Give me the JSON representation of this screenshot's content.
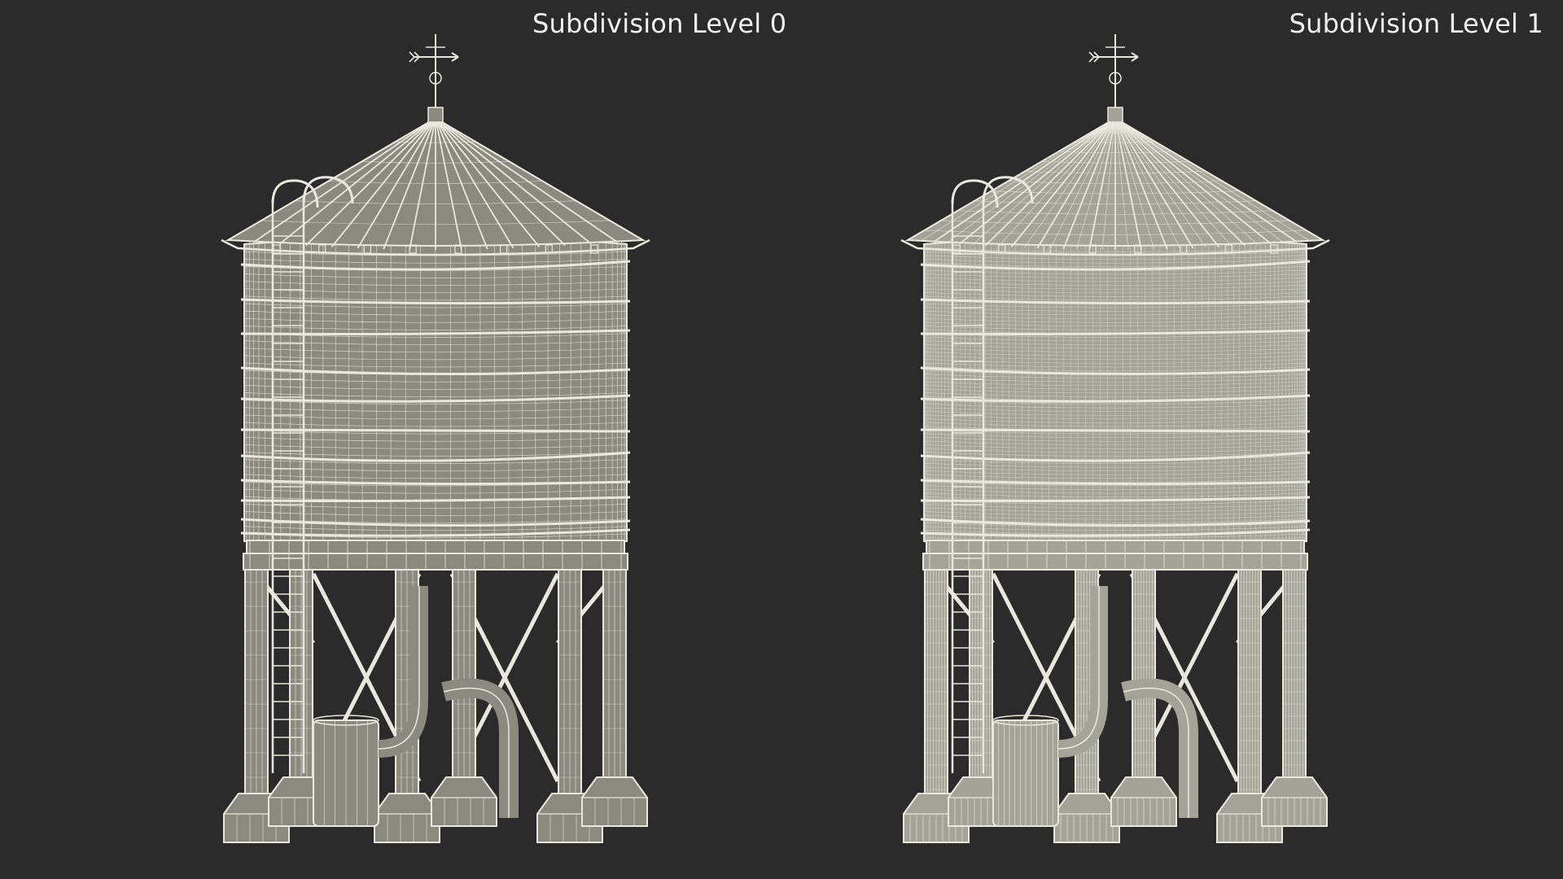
{
  "labels": {
    "left": "Subdivision Level 0",
    "right": "Subdivision Level 1"
  },
  "render": {
    "background": "#2b2b2b",
    "wire_color": "#e8e8dd",
    "surface_color_level0": "#8a8a80",
    "surface_color_level1": "#a3a398"
  }
}
